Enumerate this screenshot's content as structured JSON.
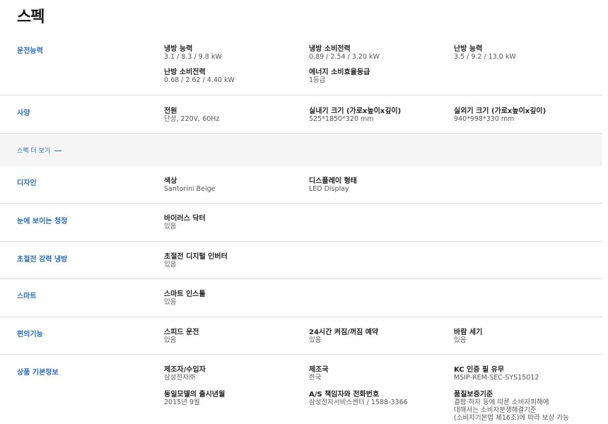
{
  "title": "스펙",
  "rows": {
    "performance": {
      "category": "운전능력",
      "cooling_capacity": {
        "label": "냉방 능력",
        "value": "3.1 / 8.3 / 9.8 kW"
      },
      "cooling_power": {
        "label": "냉방 소비전력",
        "value": "0.89 / 2.54 / 3.20 kW"
      },
      "heating_capacity": {
        "label": "난방 능력",
        "value": "3.5 / 9.2 / 13.0 kW"
      },
      "heating_power": {
        "label": "난방 소비전력",
        "value": "0.68 / 2.62 / 4.40 kW"
      },
      "energy_grade": {
        "label": "에너지 소비효율등급",
        "value": "1등급"
      }
    },
    "spec": {
      "category": "사양",
      "power": {
        "label": "전원",
        "value": "단상, 220V, 60Hz"
      },
      "indoor_size": {
        "label": "실내기 크기 (가로x높이x깊이)",
        "value": "525*1850*320 mm"
      },
      "outdoor_size": {
        "label": "실외기 크기 (가로x높이x깊이)",
        "value": "940*998*330 mm"
      }
    },
    "more": {
      "label": "스펙 더 보기"
    },
    "design": {
      "category": "디자인",
      "color": {
        "label": "색상",
        "value": "Santorini Beige"
      },
      "display": {
        "label": "디스플레이 형태",
        "value": "LED Display"
      }
    },
    "visible_clean": {
      "category": "눈에 보이는 청정",
      "virus_doctor": {
        "label": "바이러스 닥터",
        "value": "있음"
      }
    },
    "power_cooling": {
      "category": "초절전 강력 냉방",
      "digital_inverter": {
        "label": "초절전 디지털 인버터",
        "value": "있음"
      }
    },
    "smart": {
      "category": "스마트",
      "smart_install": {
        "label": "스마트 인스톨",
        "value": "있음"
      }
    },
    "convenience": {
      "category": "편의기능",
      "speed_run": {
        "label": "스피드 운전",
        "value": "있음"
      },
      "timer": {
        "label": "24시간 켜짐/꺼짐 예약",
        "value": "있음"
      },
      "wind_strength": {
        "label": "바람 세기",
        "value": "있음"
      }
    },
    "basic_info": {
      "category": "상품 기본정보",
      "manufacturer": {
        "label": "제조자/수입자",
        "value": "삼성전자㈜"
      },
      "country": {
        "label": "제조국",
        "value": "한국"
      },
      "kc": {
        "label": "KC 인증 필 유무",
        "value": "MSIP-REM-SEC-SYS15012"
      },
      "release": {
        "label": "동일모델의 출시년월",
        "value": "2015년 9월"
      },
      "as_contact": {
        "label": "A/S 책임자와 전화번호",
        "value": "삼성전자서비스센터 / 1588-3366"
      },
      "quality": {
        "label": "품질보증기준",
        "value_lines": [
          "결함·하자 등에 따른 소비자피해에",
          "대해서는 소비자분쟁해결기준",
          "(소비자기본법 제16조)에 따라 보상 가능"
        ]
      }
    }
  }
}
